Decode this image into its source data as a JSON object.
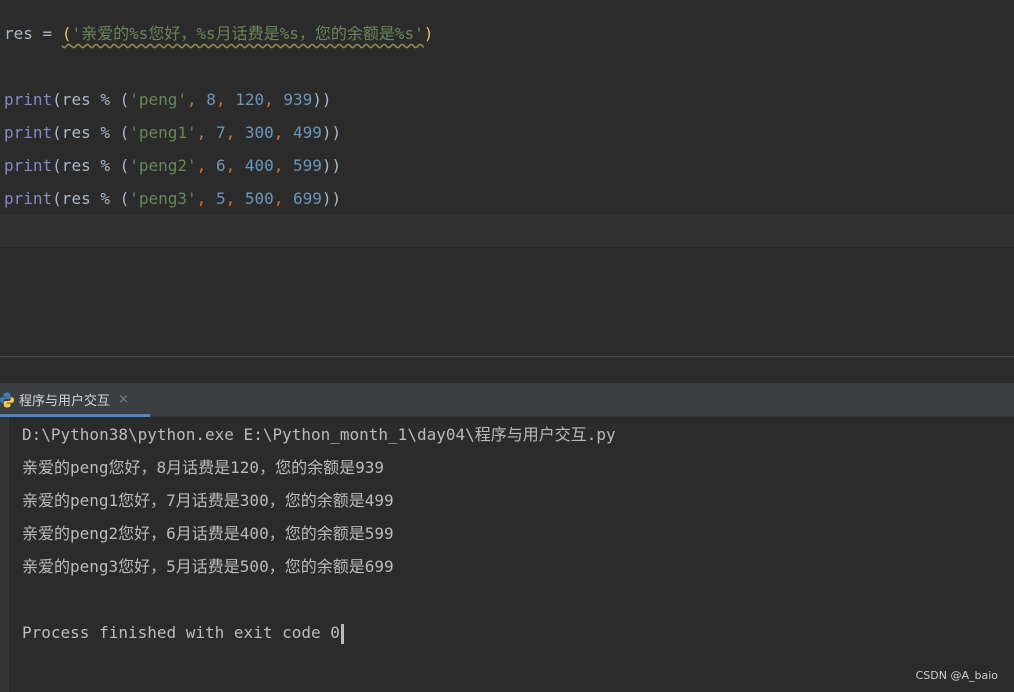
{
  "editor": {
    "line1": {
      "var": "res",
      "op": " = ",
      "open": "(",
      "str": "'亲爱的%s您好，%s月话费是%s，您的余额是%s'",
      "close": ")"
    },
    "prints": [
      {
        "fn": "print",
        "pre": "(res % (",
        "str": "'peng'",
        "n1": "8",
        "n2": "120",
        "n3": "939",
        "post": "))"
      },
      {
        "fn": "print",
        "pre": "(res % (",
        "str": "'peng1'",
        "n1": "7",
        "n2": "300",
        "n3": "499",
        "post": "))"
      },
      {
        "fn": "print",
        "pre": "(res % (",
        "str": "'peng2'",
        "n1": "6",
        "n2": "400",
        "n3": "599",
        "post": "))"
      },
      {
        "fn": "print",
        "pre": "(res % (",
        "str": "'peng3'",
        "n1": "5",
        "n2": "500",
        "n3": "699",
        "post": "))"
      }
    ],
    "comma": ", "
  },
  "run_tab": {
    "label": "程序与用户交互",
    "close": "×",
    "icon": "python-icon"
  },
  "console": {
    "command": "D:\\Python38\\python.exe E:\\Python_month_1\\day04\\程序与用户交互.py",
    "outputs": [
      "亲爱的peng您好，8月话费是120，您的余额是939",
      "亲爱的peng1您好，7月话费是300，您的余额是499",
      "亲爱的peng2您好，6月话费是400，您的余额是599",
      "亲爱的peng3您好，5月话费是500，您的余额是699"
    ],
    "exit": "Process finished with exit code 0"
  },
  "watermark": "CSDN @A_baio",
  "colors": {
    "background": "#2b2b2b",
    "string": "#6a8759",
    "number": "#6897bb",
    "keyword": "#cc7832",
    "builtin": "#8888c6"
  }
}
